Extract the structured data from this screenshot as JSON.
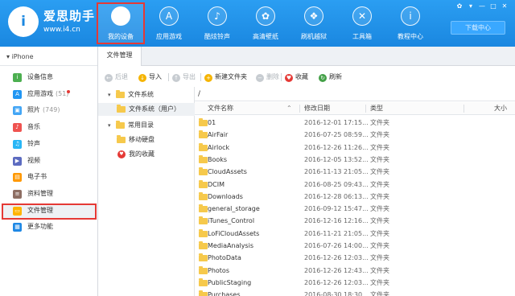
{
  "header": {
    "brand": "爱思助手",
    "url": "www.i4.cn",
    "logo_text": "i",
    "nav": [
      {
        "label": "我的设备",
        "icon": "apple-icon",
        "glyph": "",
        "active": true
      },
      {
        "label": "应用游戏",
        "icon": "app-store-icon",
        "glyph": "A",
        "active": false
      },
      {
        "label": "酷炫铃声",
        "icon": "bell-icon",
        "glyph": "♪",
        "active": false
      },
      {
        "label": "高清壁纸",
        "icon": "flower-icon",
        "glyph": "✿",
        "active": false
      },
      {
        "label": "刷机越狱",
        "icon": "dropbox-icon",
        "glyph": "❖",
        "active": false
      },
      {
        "label": "工具箱",
        "icon": "tools-icon",
        "glyph": "✕",
        "active": false
      },
      {
        "label": "教程中心",
        "icon": "info-icon",
        "glyph": "i",
        "active": false
      }
    ],
    "download_center": "下载中心",
    "window_controls": [
      "✿",
      "▾",
      "—",
      "□",
      "✕"
    ]
  },
  "sidebar": {
    "device": "iPhone",
    "items": [
      {
        "label": "设备信息",
        "count": "",
        "icon": "info-icon",
        "color": "#4caf50",
        "glyph": "i",
        "active": false,
        "dot": false
      },
      {
        "label": "应用游戏",
        "count": "(51)",
        "icon": "app-store-icon",
        "color": "#2196f3",
        "glyph": "A",
        "active": false,
        "dot": true
      },
      {
        "label": "照片",
        "count": "(749)",
        "icon": "photo-icon",
        "color": "#42a5f5",
        "glyph": "▣",
        "active": false,
        "dot": false
      },
      {
        "label": "音乐",
        "count": "",
        "icon": "music-icon",
        "color": "#ef5350",
        "glyph": "♪",
        "active": false,
        "dot": false
      },
      {
        "label": "铃声",
        "count": "",
        "icon": "bell-icon",
        "color": "#29b6f6",
        "glyph": "♫",
        "active": false,
        "dot": false
      },
      {
        "label": "视频",
        "count": "",
        "icon": "video-icon",
        "color": "#5c6bc0",
        "glyph": "▶",
        "active": false,
        "dot": false
      },
      {
        "label": "电子书",
        "count": "",
        "icon": "book-icon",
        "color": "#ff9800",
        "glyph": "▤",
        "active": false,
        "dot": false
      },
      {
        "label": "资料管理",
        "count": "",
        "icon": "document-icon",
        "color": "#8d6e63",
        "glyph": "≡",
        "active": false,
        "dot": false
      },
      {
        "label": "文件管理",
        "count": "",
        "icon": "file-icon",
        "color": "#ffb300",
        "glyph": "▭",
        "active": true,
        "dot": false
      },
      {
        "label": "更多功能",
        "count": "",
        "icon": "grid-icon",
        "color": "#1e88e5",
        "glyph": "▦",
        "active": false,
        "dot": false
      }
    ]
  },
  "tabs": [
    "文件管理"
  ],
  "toolbar": [
    {
      "label": "后退",
      "icon": "back-icon",
      "color": "#c7ccd1",
      "glyph": "←",
      "disabled": true
    },
    {
      "label": "导入",
      "icon": "import-icon",
      "color": "#f5b400",
      "glyph": "↓",
      "disabled": false
    },
    {
      "label": "导出",
      "icon": "export-icon",
      "color": "#c7ccd1",
      "glyph": "↑",
      "disabled": true
    },
    {
      "label": "新建文件夹",
      "icon": "new-folder-icon",
      "color": "#f5b400",
      "glyph": "+",
      "disabled": false
    },
    {
      "label": "删除",
      "icon": "delete-icon",
      "color": "#c7ccd1",
      "glyph": "−",
      "disabled": true
    },
    {
      "label": "收藏",
      "icon": "heart-icon",
      "color": "#e53935",
      "glyph": "♥",
      "disabled": false
    },
    {
      "label": "刷新",
      "icon": "refresh-icon",
      "color": "#43a047",
      "glyph": "↻",
      "disabled": false
    }
  ],
  "tree": {
    "file_system": "文件系统",
    "file_system_user": "文件系统（用户）",
    "common_dirs": "常用目录",
    "mobile_disk": "移动硬盘",
    "my_favorites": "我的收藏"
  },
  "path": "/",
  "columns": {
    "name": "文件名称",
    "modified": "修改日期",
    "type": "类型",
    "size": "大小"
  },
  "files": [
    {
      "name": "01",
      "date": "2016-12-01 17:15...",
      "type": "文件夹"
    },
    {
      "name": "AirFair",
      "date": "2016-07-25 08:59...",
      "type": "文件夹"
    },
    {
      "name": "Airlock",
      "date": "2016-12-26 11:26...",
      "type": "文件夹"
    },
    {
      "name": "Books",
      "date": "2016-12-05 13:52...",
      "type": "文件夹"
    },
    {
      "name": "CloudAssets",
      "date": "2016-11-13 21:05...",
      "type": "文件夹"
    },
    {
      "name": "DCIM",
      "date": "2016-08-25 09:43...",
      "type": "文件夹"
    },
    {
      "name": "Downloads",
      "date": "2016-12-28 06:13...",
      "type": "文件夹"
    },
    {
      "name": "general_storage",
      "date": "2016-09-12 15:47...",
      "type": "文件夹"
    },
    {
      "name": "iTunes_Control",
      "date": "2016-12-16 12:16...",
      "type": "文件夹"
    },
    {
      "name": "LoFiCloudAssets",
      "date": "2016-11-21 21:05...",
      "type": "文件夹"
    },
    {
      "name": "MediaAnalysis",
      "date": "2016-07-26 14:00...",
      "type": "文件夹"
    },
    {
      "name": "PhotoData",
      "date": "2016-12-26 12:03...",
      "type": "文件夹"
    },
    {
      "name": "Photos",
      "date": "2016-12-26 12:43...",
      "type": "文件夹"
    },
    {
      "name": "PublicStaging",
      "date": "2016-12-26 12:03...",
      "type": "文件夹"
    },
    {
      "name": "Purchases",
      "date": "2016-08-30 18:30...",
      "type": "文件夹"
    }
  ]
}
